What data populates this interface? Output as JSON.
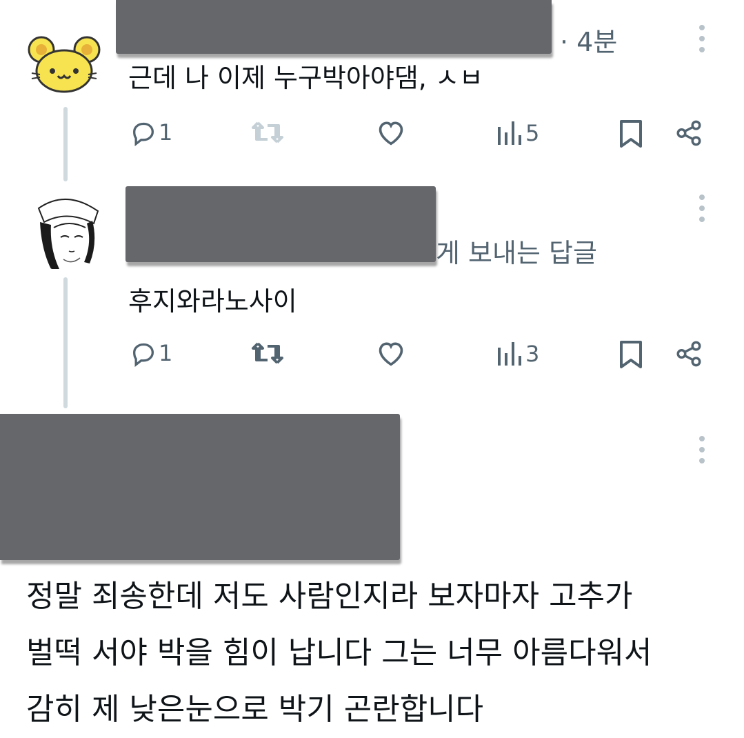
{
  "tweet1": {
    "time": "· 4분",
    "text": "근데 나 이제 누구박아야댐, ㅅㅂ",
    "reply_count": "1",
    "view_count": "5"
  },
  "tweet2": {
    "header_suffix": "게 보내는 답글",
    "text": "후지와라노사이",
    "reply_count": "1",
    "view_count": "3"
  },
  "tweet3": {
    "lines": [
      "정말 죄송한데 저도 사람인지라 보자마자 고추가",
      "벌떡 서야 박을 힘이 납니다 그는 너무 아름다워서",
      "감히 제 낮은눈으로 박기 곤란합니다"
    ]
  },
  "colors": {
    "icon_gray": "#536471",
    "retweet_disabled": "#c4cfd6",
    "thread_line": "#cfd9de",
    "redaction": "#66676a",
    "avatar_yellow": "#f7e34f"
  },
  "icons": [
    "reply-icon",
    "retweet-icon",
    "like-icon",
    "views-icon",
    "bookmark-icon",
    "share-icon",
    "more-icon"
  ]
}
